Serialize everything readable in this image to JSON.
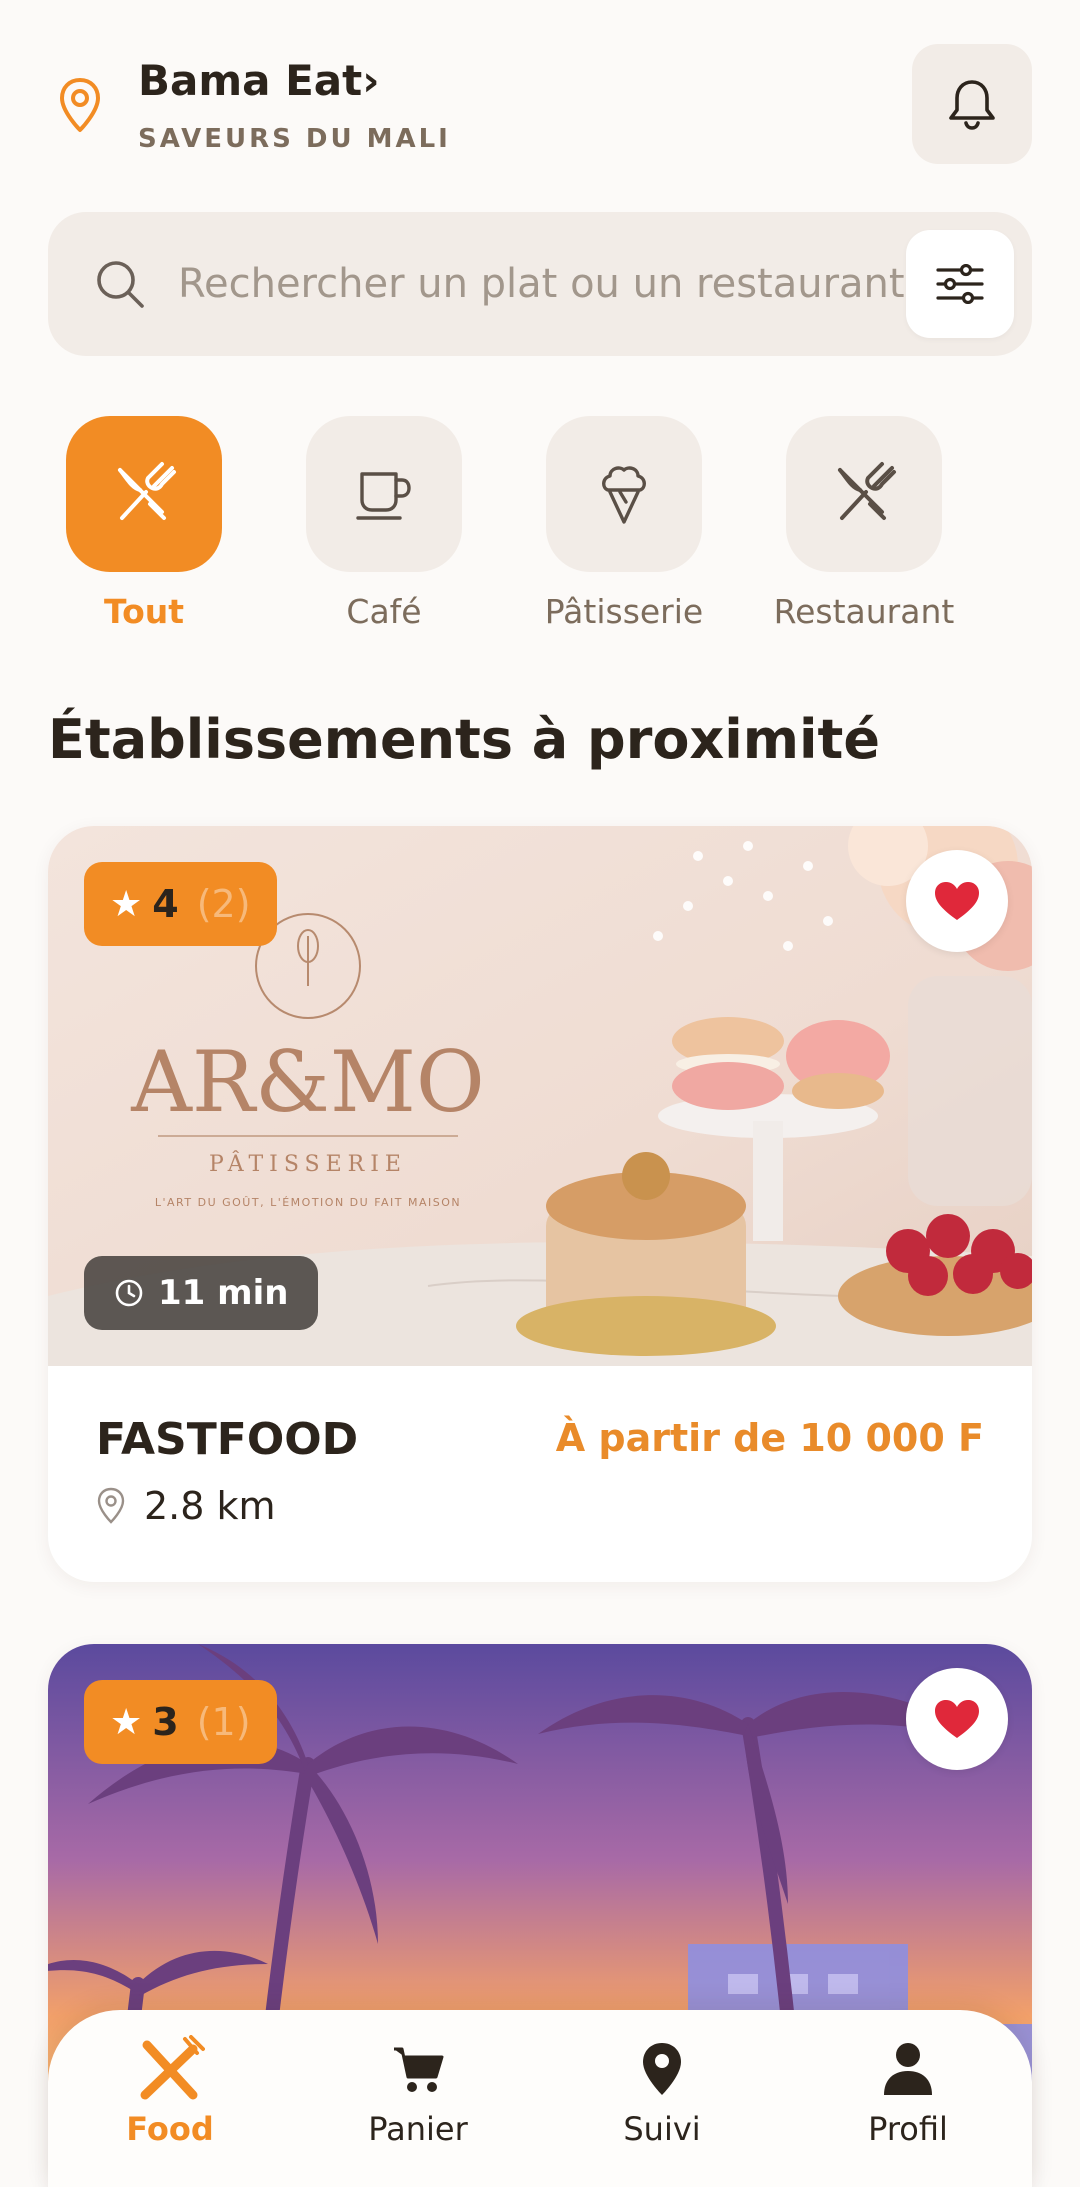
{
  "header": {
    "brand": "Bama Eat›",
    "tagline": "SAVEURS DU MALI"
  },
  "search": {
    "placeholder": "Rechercher un plat ou un restaurant"
  },
  "categories": [
    {
      "label": "Tout",
      "icon": "utensils-icon",
      "active": true
    },
    {
      "label": "Café",
      "icon": "coffee-cup-icon",
      "active": false
    },
    {
      "label": "Pâtisserie",
      "icon": "ice-cream-icon",
      "active": false
    },
    {
      "label": "Restaurant",
      "icon": "utensils-icon",
      "active": false
    }
  ],
  "section_title": "Établissements à proximité",
  "listings": [
    {
      "rating": "4",
      "rating_count": "(2)",
      "time": "11 min",
      "name": "FASTFOOD",
      "price": "À partir de 10 000 F",
      "distance": "2.8 km",
      "image_brand": "AR&MO",
      "image_subtitle": "PÂTISSERIE",
      "image_tagline": "L'ART DU GOÛT, L'ÉMOTION DU FAIT MAISON",
      "favorite": true
    },
    {
      "rating": "3",
      "rating_count": "(1)",
      "favorite": true
    }
  ],
  "bottom_nav": [
    {
      "label": "Food",
      "icon": "food-icon",
      "active": true
    },
    {
      "label": "Panier",
      "icon": "cart-icon",
      "active": false
    },
    {
      "label": "Suivi",
      "icon": "map-pin-icon",
      "active": false
    },
    {
      "label": "Profil",
      "icon": "user-icon",
      "active": false
    }
  ],
  "colors": {
    "accent": "#f28c24",
    "background": "#fcfaf8",
    "tile": "#f2ece7",
    "text": "#2c241c",
    "muted": "#7c6c5c",
    "favorite": "#e0283a"
  }
}
